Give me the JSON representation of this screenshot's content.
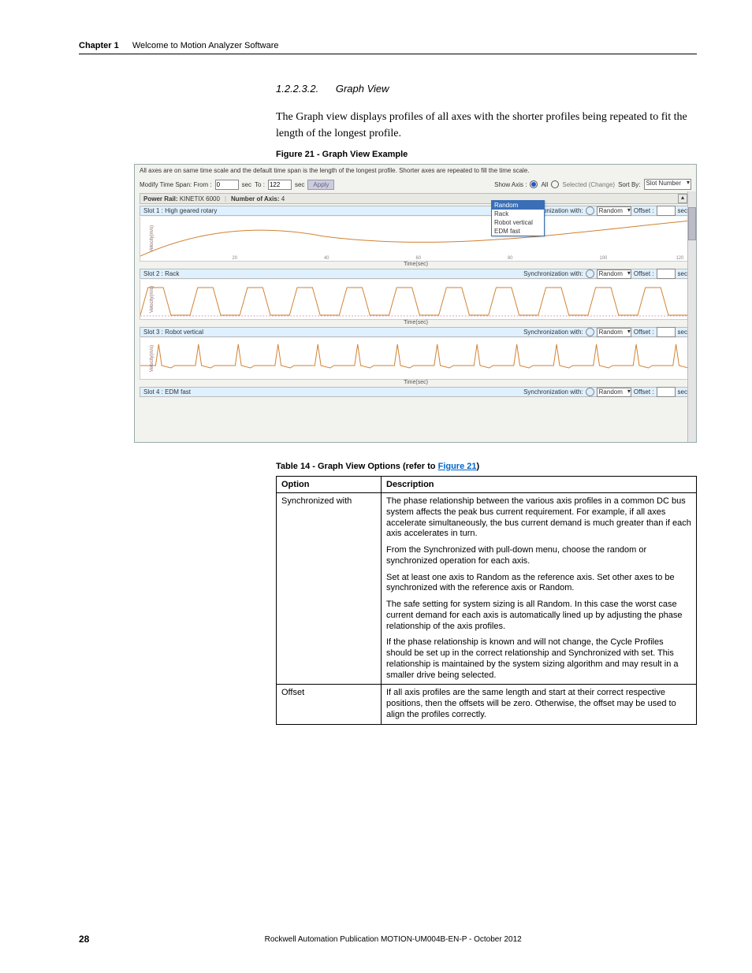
{
  "header": {
    "chapter": "Chapter 1",
    "title": "Welcome to Motion Analyzer Software"
  },
  "section": {
    "number": "1.2.2.3.2.",
    "title": "Graph View"
  },
  "para1": "The Graph view displays profiles of all axes with the shorter profiles being repeated to fit the length of the longest profile.",
  "fig_caption": "Figure 21 - Graph View Example",
  "screenshot": {
    "topnote": "All axes are on same time scale and the default time span is the length of the longest profile. Shorter axes are repeated to fill the time scale.",
    "modify_label": "Modify Time Span: From :",
    "from_val": "0",
    "unit_sec": "sec",
    "to_label": "To :",
    "to_val": "122",
    "unit_sec2": "sec",
    "apply": "Apply",
    "show_axis": "Show Axis :",
    "all": "All",
    "selected": "Selected (Change)",
    "sortby": "Sort By:",
    "sort_val": "Slot Number",
    "strip_rail_label": "Power Rail:",
    "strip_rail_val": "KINETIX 6000",
    "strip_numaxis_label": "Number of Axis:",
    "strip_numaxis_val": "4",
    "slot1": "Slot 1 :  High geared rotary",
    "slot2": "Slot 2 :  Rack",
    "slot3": "Slot 3 :  Robot vertical",
    "slot4": "Slot 4 :  EDM fast",
    "sync_label": "Synchronization with:",
    "sync_val": "Random",
    "offset_label": "Offset :",
    "dd_items": [
      "Random",
      "Rack",
      "Robot vertical",
      "EDM fast"
    ],
    "time_axis": "Time(sec)",
    "y_axis": "Velocity(m/s)",
    "ticks": [
      "20",
      "40",
      "60",
      "80",
      "100",
      "120"
    ]
  },
  "tbl_caption_prefix": "Table 14 - Graph View Options (refer to ",
  "tbl_caption_link": "Figure 21",
  "tbl_caption_suffix": ")",
  "table": {
    "h1": "Option",
    "h2": "Description",
    "r1_opt": "Synchronized with",
    "r1_p1": "The phase relationship between the various axis profiles in a common DC bus system affects the peak bus current requirement. For example, if all axes accelerate simultaneously, the bus current demand is much greater than if each axis accelerates in turn.",
    "r1_p2": "From the Synchronized with pull-down menu, choose the random or synchronized operation for each axis.",
    "r1_p3": "Set at least one axis to Random as the reference axis. Set other axes to be synchronized with the reference axis or Random.",
    "r1_p4": "The safe setting for system sizing is all Random. In this case the worst case current demand for each axis is automatically lined up by adjusting the phase relationship of the axis profiles.",
    "r1_p5": "If the phase relationship is known and will not change, the Cycle Profiles should be set up in the correct relationship and Synchronized with set. This relationship is maintained by the system sizing algorithm and may result in a smaller drive being selected.",
    "r2_opt": "Offset",
    "r2_p1": "If all axis profiles are the same length and start at their correct respective positions, then the offsets will be zero. Otherwise, the offset may be used to align the profiles correctly."
  },
  "footer": {
    "page": "28",
    "pub": "Rockwell Automation Publication MOTION-UM004B-EN-P - October 2012"
  }
}
